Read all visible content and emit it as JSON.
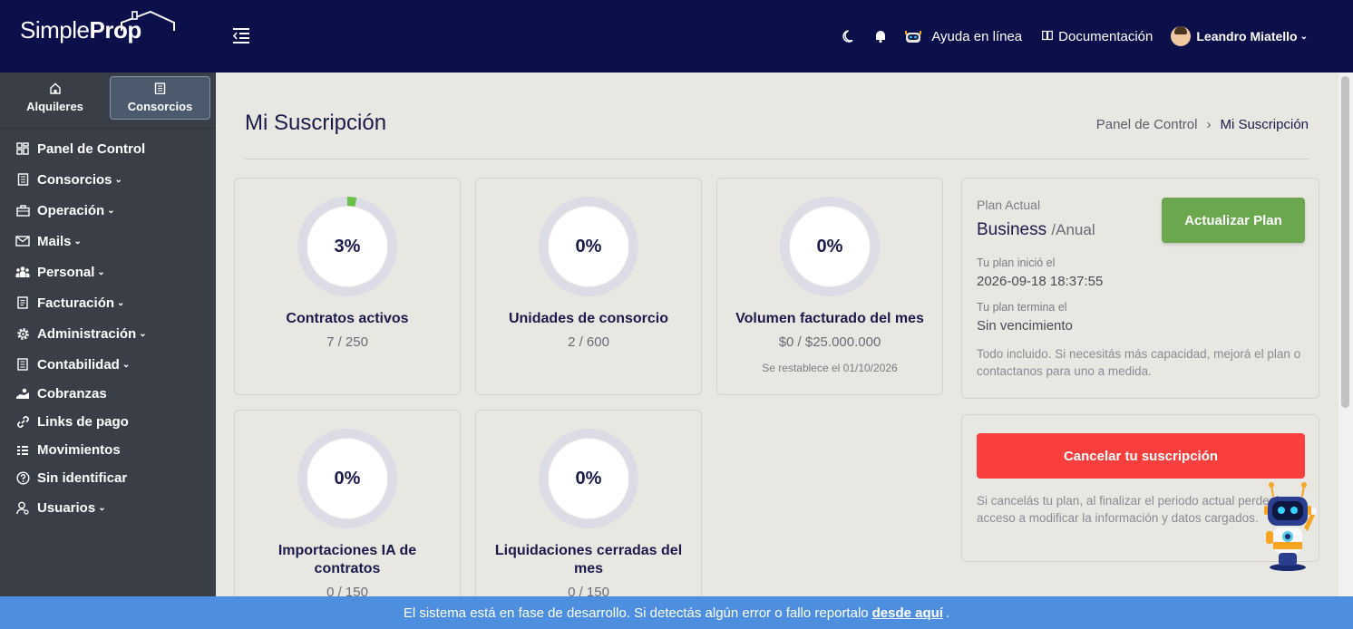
{
  "app": {
    "logo_simple": "Simple",
    "logo_prop": "Prop"
  },
  "header": {
    "help_label": "Ayuda en línea",
    "docs_label": "Documentación",
    "user_name": "Leandro Miatello"
  },
  "sidebar": {
    "switcher": [
      {
        "label": "Alquileres",
        "icon": "home-icon",
        "active": false
      },
      {
        "label": "Consorcios",
        "icon": "building-icon",
        "active": true
      }
    ],
    "items": [
      {
        "label": "Panel de Control",
        "icon": "dashboard-icon",
        "dropdown": false
      },
      {
        "label": "Consorcios",
        "icon": "building-icon",
        "dropdown": true
      },
      {
        "label": "Operación",
        "icon": "briefcase-icon",
        "dropdown": true
      },
      {
        "label": "Mails",
        "icon": "mail-icon",
        "dropdown": true
      },
      {
        "label": "Personal",
        "icon": "people-icon",
        "dropdown": true
      },
      {
        "label": "Facturación",
        "icon": "invoice-icon",
        "dropdown": true
      },
      {
        "label": "Administración",
        "icon": "gear-icon",
        "dropdown": true
      },
      {
        "label": "Contabilidad",
        "icon": "ledger-icon",
        "dropdown": true
      },
      {
        "label": "Cobranzas",
        "icon": "cash-icon",
        "dropdown": false
      },
      {
        "label": "Links de pago",
        "icon": "link-icon",
        "dropdown": false
      },
      {
        "label": "Movimientos",
        "icon": "list-icon",
        "dropdown": false
      },
      {
        "label": "Sin identificar",
        "icon": "question-icon",
        "dropdown": false
      },
      {
        "label": "Usuarios",
        "icon": "user-icon",
        "dropdown": true
      }
    ]
  },
  "page": {
    "title": "Mi Suscripción",
    "breadcrumb": [
      "Panel de Control",
      "Mi Suscripción"
    ]
  },
  "usage_cards": [
    {
      "percent_label": "3%",
      "percent": 3,
      "title": "Contratos activos",
      "sub": "7 / 250",
      "note": ""
    },
    {
      "percent_label": "0%",
      "percent": 0,
      "title": "Unidades de consorcio",
      "sub": "2 / 600",
      "note": ""
    },
    {
      "percent_label": "0%",
      "percent": 0,
      "title": "Volumen facturado del mes",
      "sub": "$0 / $25.000.000",
      "note": "Se restablece el 01/10/2026"
    },
    {
      "percent_label": "0%",
      "percent": 0,
      "title": "Importaciones IA de contratos",
      "sub": "0 / 150",
      "note": ""
    },
    {
      "percent_label": "0%",
      "percent": 0,
      "title": "Liquidaciones cerradas del mes",
      "sub": "0 / 150",
      "note": ""
    }
  ],
  "plan": {
    "label": "Plan Actual",
    "name": "Business",
    "period": "/Anual",
    "upgrade_label": "Actualizar Plan",
    "start_label": "Tu plan inició el",
    "start_value": "2026-09-18 18:37:55",
    "end_label": "Tu plan termina el",
    "end_value": "Sin vencimiento",
    "description": "Todo incluido. Si necesitás más capacidad, mejorá el plan o contactanos para uno a medida."
  },
  "cancel": {
    "button_label": "Cancelar tu suscripción",
    "description": "Si cancelás tu plan, al finalizar el periodo actual perderás acceso a modificar la información y datos cargados."
  },
  "devbar": {
    "text": "El sistema está en fase de desarrollo. Si detectás algún error o fallo reportalo",
    "link": "desde aquí",
    "suffix": "."
  },
  "colors": {
    "accent_green": "#6aa74e",
    "danger": "#fb3f3f",
    "ring_fill": "#6cc04a",
    "topbar": "#0b0f4a"
  }
}
